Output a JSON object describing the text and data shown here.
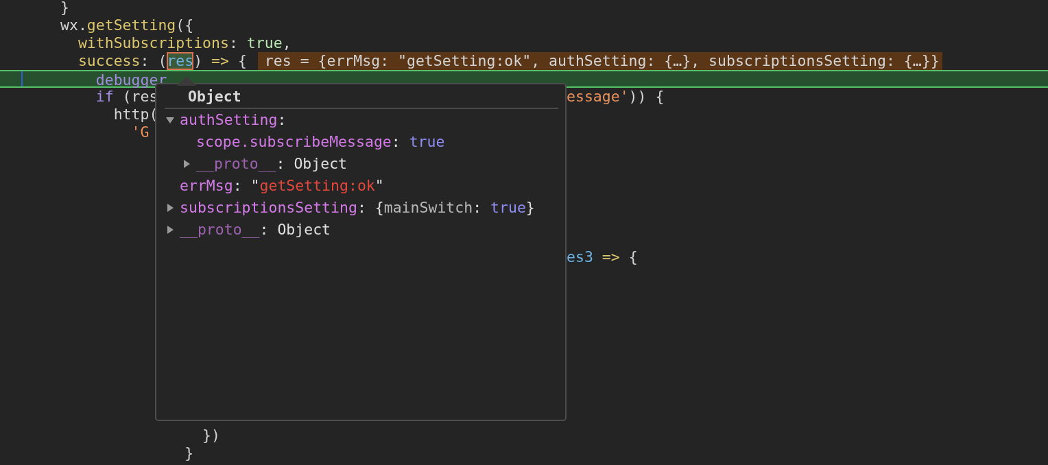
{
  "code_lines": [
    {
      "kind": "normal",
      "parts": [
        {
          "kind": "code",
          "tokens": [
            {
              "t": "}",
              "kind": "plain"
            }
          ]
        }
      ]
    },
    {
      "kind": "normal",
      "parts": [
        {
          "kind": "code",
          "tokens": [
            {
              "t": "wx.",
              "kind": "plain"
            },
            {
              "t": "getSetting",
              "kind": "fn"
            },
            {
              "t": "({",
              "kind": "plain"
            }
          ]
        }
      ]
    },
    {
      "kind": "normal",
      "parts": [
        {
          "kind": "code",
          "tokens": [
            {
              "t": "  withSubscriptions",
              "kind": "fn"
            },
            {
              "t": ": ",
              "kind": "plain"
            },
            {
              "t": "true",
              "kind": "bool"
            },
            {
              "t": ",",
              "kind": "plain"
            }
          ]
        }
      ]
    },
    {
      "kind": "normal",
      "parts": [
        {
          "kind": "code",
          "tokens": [
            {
              "t": "  success",
              "kind": "fn"
            },
            {
              "t": ": (",
              "kind": "plain"
            }
          ]
        },
        {
          "kind": "hover",
          "tokens": [
            {
              "t": "res",
              "kind": "param"
            }
          ]
        },
        {
          "kind": "code",
          "tokens": [
            {
              "t": ") ",
              "kind": "plain"
            },
            {
              "t": "=>",
              "kind": "fn"
            },
            {
              "t": " {",
              "kind": "plain"
            }
          ]
        },
        {
          "kind": "inline_value",
          "tokens": [
            {
              "t": "res = {errMsg: \"getSetting:ok\", authSetting: {…}, subscriptionsSetting: {…}}",
              "kind": "plain"
            }
          ]
        }
      ]
    },
    {
      "kind": "current",
      "parts": [
        {
          "kind": "code",
          "tokens": [
            {
              "t": "    debugger",
              "kind": "keyword"
            }
          ]
        }
      ]
    },
    {
      "kind": "normal",
      "parts": [
        {
          "kind": "code",
          "tokens": [
            {
              "t": "    if",
              "kind": "keyword"
            },
            {
              "t": " (res",
              "kind": "plain"
            }
          ]
        },
        {
          "kind": "after_popup",
          "tokens": [
            {
              "t": "essage'",
              "kind": "string"
            },
            {
              "t": ")) {",
              "kind": "plain"
            }
          ]
        }
      ]
    },
    {
      "kind": "normal",
      "parts": [
        {
          "kind": "code",
          "tokens": [
            {
              "t": "      http(",
              "kind": "plain"
            }
          ]
        }
      ]
    },
    {
      "kind": "normal",
      "parts": [
        {
          "kind": "code",
          "tokens": [
            {
              "t": "        'G",
              "kind": "string"
            }
          ]
        }
      ]
    },
    {
      "kind": "normal"
    },
    {
      "kind": "normal"
    },
    {
      "kind": "normal"
    },
    {
      "kind": "normal"
    },
    {
      "kind": "normal"
    },
    {
      "kind": "normal"
    },
    {
      "kind": "normal",
      "parts": [
        {
          "kind": "after_popup",
          "tokens": [
            {
              "t": "es3",
              "kind": "param"
            },
            {
              "t": " =>",
              "kind": "fn"
            },
            {
              "t": " {",
              "kind": "plain"
            }
          ]
        }
      ]
    },
    {
      "kind": "normal"
    },
    {
      "kind": "normal"
    },
    {
      "kind": "normal"
    },
    {
      "kind": "normal"
    },
    {
      "kind": "normal"
    },
    {
      "kind": "normal"
    },
    {
      "kind": "normal"
    },
    {
      "kind": "normal"
    },
    {
      "kind": "normal"
    },
    {
      "kind": "normal",
      "parts": [
        {
          "kind": "code",
          "tokens": [
            {
              "t": "                })",
              "kind": "plain"
            }
          ]
        }
      ]
    },
    {
      "kind": "normal",
      "parts": [
        {
          "kind": "code",
          "tokens": [
            {
              "t": "              }",
              "kind": "plain"
            }
          ]
        }
      ]
    }
  ],
  "popup": {
    "title": "Object",
    "nodes": [
      {
        "key": "authSetting",
        "kind": "own",
        "expanded": true,
        "value": [
          {
            "t": ":",
            "kind": "plain"
          }
        ],
        "children": [
          {
            "key": "scope.subscribeMessage",
            "kind": "own",
            "value": [
              {
                "t": ": ",
                "kind": "plain"
              },
              {
                "t": "true",
                "kind": "bool"
              }
            ]
          },
          {
            "key": "__proto__",
            "kind": "proto",
            "expanded": false,
            "value": [
              {
                "t": ": Object",
                "kind": "plain"
              }
            ]
          }
        ]
      },
      {
        "key": "errMsg",
        "kind": "own",
        "value": [
          {
            "t": ": \"",
            "kind": "plain"
          },
          {
            "t": "getSetting:ok",
            "kind": "string"
          },
          {
            "t": "\"",
            "kind": "plain"
          }
        ]
      },
      {
        "key": "subscriptionsSetting",
        "kind": "own",
        "expanded": false,
        "value": [
          {
            "t": ": {",
            "kind": "plain"
          },
          {
            "t": "mainSwitch",
            "kind": "dim"
          },
          {
            "t": ": ",
            "kind": "plain"
          },
          {
            "t": "true",
            "kind": "bool"
          },
          {
            "t": "}",
            "kind": "plain"
          }
        ]
      },
      {
        "key": "__proto__",
        "kind": "proto",
        "expanded": false,
        "value": [
          {
            "t": ": Object",
            "kind": "plain"
          }
        ]
      }
    ]
  }
}
